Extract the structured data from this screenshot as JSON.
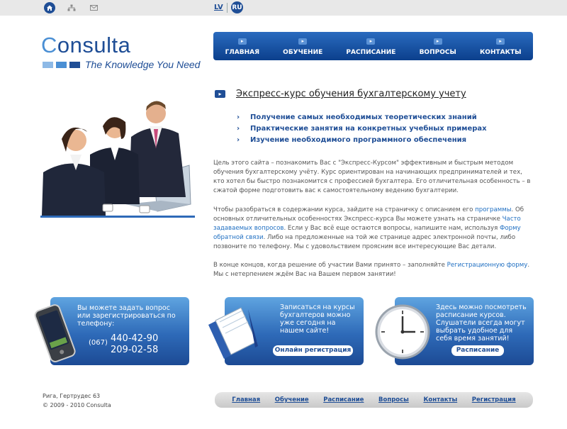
{
  "topbar": {
    "icons": [
      "home-icon",
      "sitemap-icon",
      "mail-icon"
    ],
    "lang_lv": "LV",
    "lang_ru": "RU"
  },
  "logo": {
    "first_letter": "C",
    "rest": "onsulta",
    "tagline": "The Knowledge You Need",
    "block_colors": [
      "#8db9e6",
      "#4a8fd4",
      "#1f4e96"
    ]
  },
  "nav": {
    "items": [
      "ГЛАВНАЯ",
      "ОБУЧЕНИЕ",
      "РАСПИСАНИЕ",
      "ВОПРОСЫ",
      "КОНТАКТЫ"
    ]
  },
  "main": {
    "heading": "Экспресс-курс обучения бухгалтерскому учету",
    "features": [
      "Получение самых необходимых теоретических знаний",
      "Практические занятия на конкретных учебных примерах",
      "Изучение необходимого программного обеспечения"
    ],
    "p1": "Цель этого сайта – познакомить Вас с \"Экспресс-Курсом\" эффективным и быстрым методом обучения бухгалтерскому учёту. Курс ориентирован на начинающих предпринимателей и тех, кто хотел бы быстро познакомится с профессией бухгалтера. Его отличительная особенность – в сжатой форме подготовить вас к самостоятельному ведению бухгалтерии.",
    "p2_a": "Чтобы разобраться в содержании курса, зайдите на страничку с описанием его ",
    "p2_link1": "программы",
    "p2_b": ". Об основных отличительных особенностях Экспресс-курса Вы можете узнать на страничке ",
    "p2_link2": "Часто задаваемых вопросов",
    "p2_c": ". Если у Вас всё еще остаются вопросы, напишите нам, используя ",
    "p2_link3": "Форму обратной связи",
    "p2_d": ". Либо на предложенные на той же странице адрес электронной почты, либо позвоните по телефону. Мы с удовольствием проясним все интересующие Вас детали.",
    "p3_a": "В конце концов, когда решение об участии Вами принято – заполняйте ",
    "p3_link": "Регистрационную форму",
    "p3_b": ". Мы с нетерпением ждём Вас на Вашем первом занятии!"
  },
  "boxes": {
    "phone": {
      "text": "Вы можете задать вопрос или зарегистрироваться по телефону:",
      "prefix": "(067)",
      "number1": "440-42-90",
      "number2": "209-02-58"
    },
    "register": {
      "text": "Записаться на курсы  бухгалтеров можно уже сегодня на нашем сайте!",
      "button": "Онлайн регистрация"
    },
    "schedule": {
      "text": "Здесь можно посмотреть расписание курсов. Слушатели всегда могут выбрать удобное для себя время занятий!",
      "button": "Расписание"
    }
  },
  "footer": {
    "address": "Рига, Гертрудес 63",
    "copyright": "© 2009 - 2010 Consulta",
    "links": [
      "Главная",
      "Обучение",
      "Расписание",
      "Вопросы",
      "Контакты",
      "Регистрация"
    ]
  }
}
